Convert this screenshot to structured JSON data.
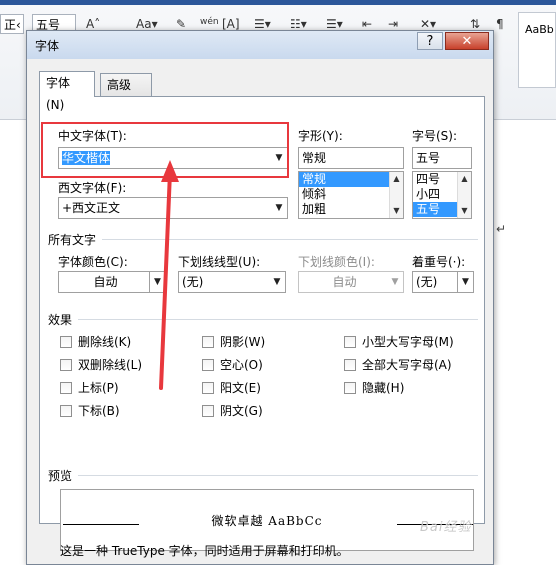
{
  "ribbon": {
    "font_size_partial": "正‹",
    "font_size": "五号",
    "style_preview": "AaBb"
  },
  "dialog": {
    "title": "字体",
    "help_label": "?",
    "close_label": "✕",
    "tabs": [
      {
        "label": "字体(N)",
        "active": true
      },
      {
        "label": "高级(V)",
        "active": false
      }
    ],
    "chinese_font": {
      "label": "中文字体(T):",
      "value": "华文楷体"
    },
    "style": {
      "label": "字形(Y):",
      "value": "常规",
      "options": [
        "常规",
        "倾斜",
        "加粗"
      ],
      "selected": "常规"
    },
    "size": {
      "label": "字号(S):",
      "value": "五号",
      "options": [
        "四号",
        "小四",
        "五号"
      ],
      "selected": "五号"
    },
    "western_font": {
      "label": "西文字体(F):",
      "value": "+西文正文"
    },
    "all_text": {
      "heading": "所有文字",
      "font_color": {
        "label": "字体颜色(C):",
        "value": "自动"
      },
      "underline_type": {
        "label": "下划线线型(U):",
        "value": "(无)"
      },
      "underline_color": {
        "label": "下划线颜色(I):",
        "value": "自动"
      },
      "emphasis": {
        "label": "着重号(·):",
        "value": "(无)"
      }
    },
    "effects": {
      "heading": "效果",
      "col1": [
        "删除线(K)",
        "双删除线(L)",
        "上标(P)",
        "下标(B)"
      ],
      "col2": [
        "阴影(W)",
        "空心(O)",
        "阳文(E)",
        "阴文(G)"
      ],
      "col3": [
        "小型大写字母(M)",
        "全部大写字母(A)",
        "隐藏(H)"
      ]
    },
    "preview": {
      "heading": "预览",
      "sample": "微软卓越 AaBbCc",
      "note": "这是一种 TrueType 字体，同时适用于屏幕和打印机。"
    }
  },
  "annotation_color": "#e8383d",
  "selection_color": "#3399ff"
}
